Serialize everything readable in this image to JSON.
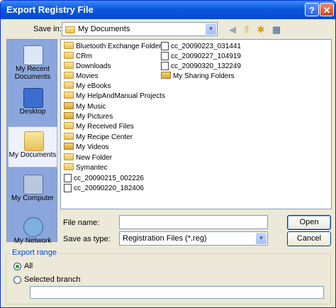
{
  "window": {
    "title": "Export Registry File",
    "help_icon": "?",
    "close_icon": "✕"
  },
  "save_in": {
    "label": "Save in:",
    "value": "My Documents"
  },
  "places": [
    {
      "label": "My Recent Documents"
    },
    {
      "label": "Desktop"
    },
    {
      "label": "My Documents"
    },
    {
      "label": "My Computer"
    },
    {
      "label": "My Network"
    }
  ],
  "files": [
    {
      "name": "Bluetooth Exchange Folder",
      "icon": "folder"
    },
    {
      "name": "CRm",
      "icon": "folder"
    },
    {
      "name": "Downloads",
      "icon": "folder"
    },
    {
      "name": "Movies",
      "icon": "folder"
    },
    {
      "name": "My eBooks",
      "icon": "folder"
    },
    {
      "name": "My HelpAndManual Projects",
      "icon": "folder"
    },
    {
      "name": "My Music",
      "icon": "music-folder"
    },
    {
      "name": "My Pictures",
      "icon": "pictures-folder"
    },
    {
      "name": "My Received Files",
      "icon": "folder"
    },
    {
      "name": "My Recipe Center",
      "icon": "folder"
    },
    {
      "name": "My Videos",
      "icon": "videos-folder"
    },
    {
      "name": "New Folder",
      "icon": "folder"
    },
    {
      "name": "Symantec",
      "icon": "folder"
    },
    {
      "name": "cc_20090215_002226",
      "icon": "registry-file"
    },
    {
      "name": "cc_20090220_182406",
      "icon": "registry-file"
    },
    {
      "name": "cc_20090223_031441",
      "icon": "registry-file"
    },
    {
      "name": "cc_20090227_104919",
      "icon": "registry-file"
    },
    {
      "name": "cc_20090320_132249",
      "icon": "registry-file"
    },
    {
      "name": "My Sharing Folders",
      "icon": "sharing-folder"
    }
  ],
  "filename": {
    "label": "File name:",
    "value": ""
  },
  "savetype": {
    "label": "Save as type:",
    "value": "Registration Files (*.reg)"
  },
  "buttons": {
    "open": "Open",
    "cancel": "Cancel"
  },
  "export_range": {
    "title": "Export range",
    "all": "All",
    "selected": "Selected branch",
    "branch_value": ""
  }
}
